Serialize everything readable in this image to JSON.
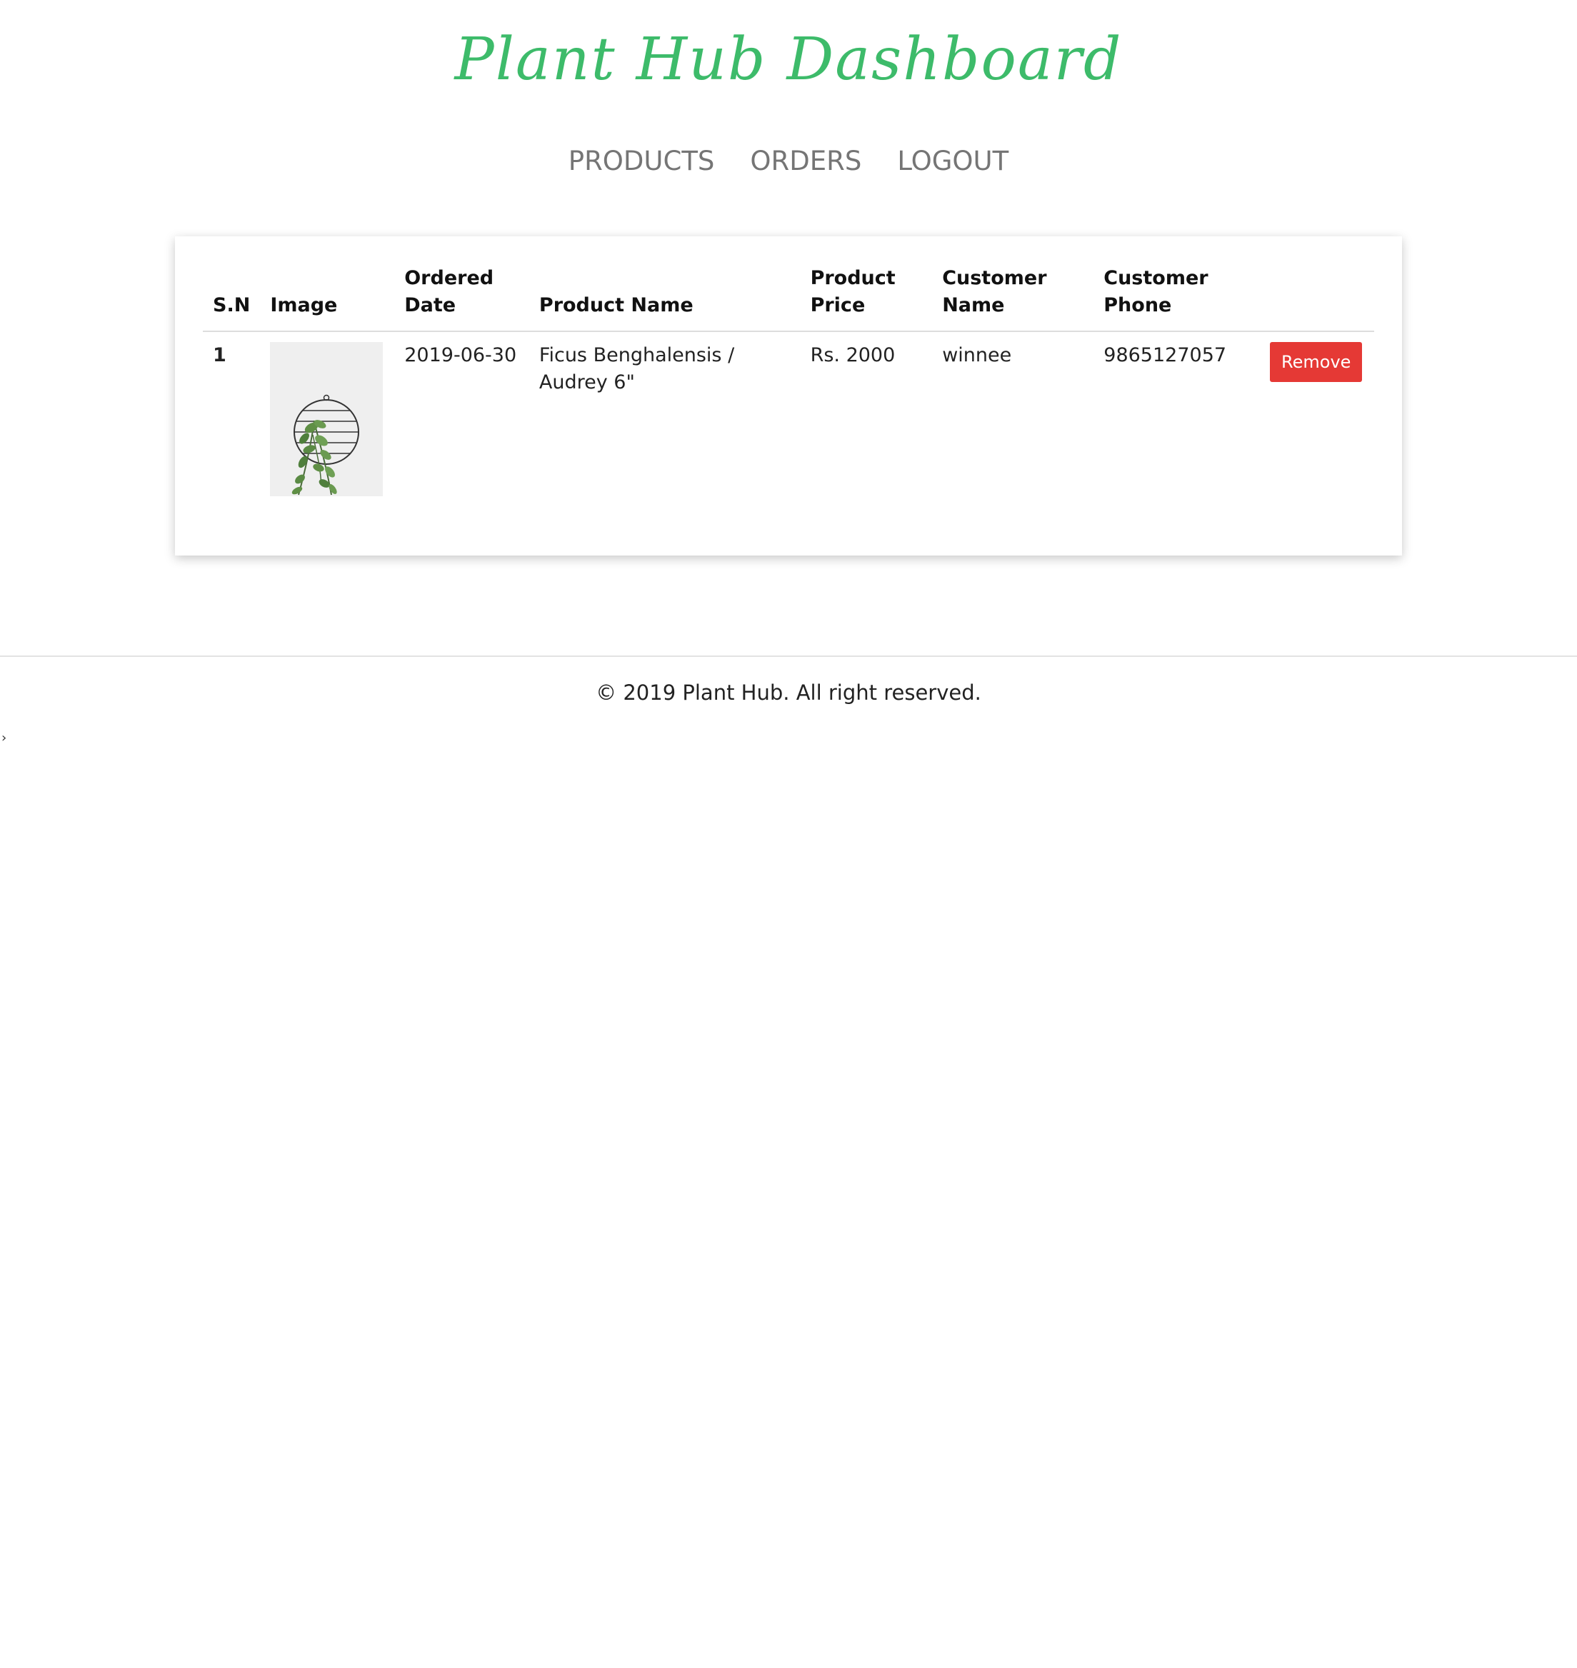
{
  "header": {
    "title": "Plant Hub Dashboard",
    "title_color": "#3dbb6a"
  },
  "nav": {
    "items": [
      {
        "label": "PRODUCTS"
      },
      {
        "label": "ORDERS"
      },
      {
        "label": "LOGOUT"
      }
    ]
  },
  "orders_table": {
    "columns": [
      "S.N",
      "Image",
      "Ordered Date",
      "Product Name",
      "Product Price",
      "Customer Name",
      "Customer Phone",
      ""
    ],
    "rows": [
      {
        "sn": "1",
        "image_icon": "hanging-plant-image",
        "ordered_date": "2019-06-30",
        "product_name": "Ficus Benghalensis / Audrey 6\"",
        "product_price": "Rs. 2000",
        "customer_name": "winnee",
        "customer_phone": "9865127057",
        "action_label": "Remove"
      }
    ]
  },
  "footer": {
    "text": "© 2019 Plant Hub. All right reserved."
  },
  "misc": {
    "caret": "›"
  },
  "colors": {
    "accent": "#3dbb6a",
    "danger": "#e53935",
    "nav_text": "#757575"
  }
}
